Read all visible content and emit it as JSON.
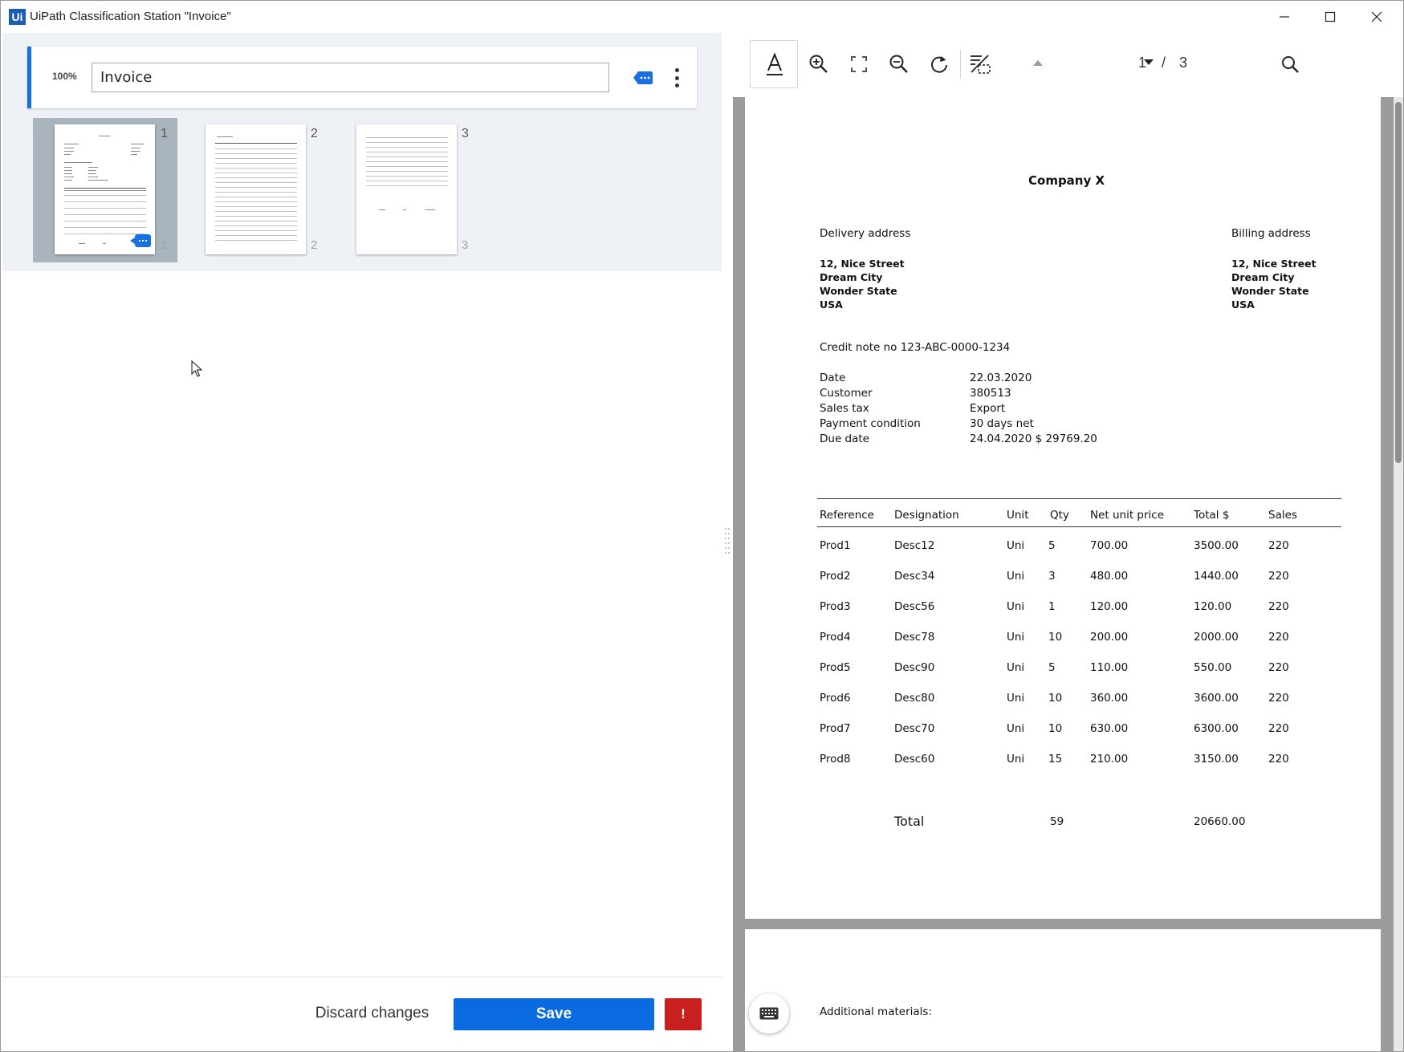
{
  "window": {
    "logo": "Ui",
    "title": "UiPath Classification Station \"Invoice\""
  },
  "document_type": {
    "confidence": "100%",
    "value": "Invoice"
  },
  "thumbnails": [
    {
      "page": "1",
      "label": "1"
    },
    {
      "page": "2",
      "label": "2"
    },
    {
      "page": "3",
      "label": "3"
    }
  ],
  "actions": {
    "discard": "Discard changes",
    "save": "Save",
    "warning": "!"
  },
  "toolbar": {
    "page_current": "1",
    "page_separator": "/",
    "page_total": "3",
    "icons": [
      "text-select-icon",
      "zoom-in-icon",
      "fit-page-icon",
      "zoom-out-icon",
      "rotate-icon",
      "toggle-regions-icon",
      "previous-page-icon",
      "next-page-icon",
      "search-icon"
    ]
  },
  "invoice": {
    "company": "Company X",
    "delivery_heading": "Delivery address",
    "billing_heading": "Billing address",
    "delivery_address": [
      "12, Nice Street",
      "Dream City",
      "Wonder State",
      "USA"
    ],
    "billing_address": [
      "12, Nice Street",
      "Dream City",
      "Wonder State",
      "USA"
    ],
    "credit_note": "Credit note no 123-ABC-0000-1234",
    "details": [
      {
        "label": "Date",
        "value": "22.03.2020"
      },
      {
        "label": "Customer",
        "value": "380513"
      },
      {
        "label": "Sales tax",
        "value": "Export"
      },
      {
        "label": "Payment condition",
        "value": "30 days net"
      },
      {
        "label": "Due date",
        "value": "24.04.2020 $ 29769.20"
      }
    ],
    "columns": [
      "Reference",
      "Designation",
      "Unit",
      "Qty",
      "Net unit price",
      "Total $",
      "Sales"
    ],
    "rows": [
      [
        "Prod1",
        "Desc12",
        "Uni",
        "5",
        "700.00",
        "3500.00",
        "220"
      ],
      [
        "Prod2",
        "Desc34",
        "Uni",
        "3",
        "480.00",
        "1440.00",
        "220"
      ],
      [
        "Prod3",
        "Desc56",
        "Uni",
        "1",
        "120.00",
        "120.00",
        "220"
      ],
      [
        "Prod4",
        "Desc78",
        "Uni",
        "10",
        "200.00",
        "2000.00",
        "220"
      ],
      [
        "Prod5",
        "Desc90",
        "Uni",
        "5",
        "110.00",
        "550.00",
        "220"
      ],
      [
        "Prod6",
        "Desc80",
        "Uni",
        "10",
        "360.00",
        "3600.00",
        "220"
      ],
      [
        "Prod7",
        "Desc70",
        "Uni",
        "10",
        "630.00",
        "6300.00",
        "220"
      ],
      [
        "Prod8",
        "Desc60",
        "Uni",
        "15",
        "210.00",
        "3150.00",
        "220"
      ]
    ],
    "total_label": "Total",
    "total_qty": "59",
    "total_amount": "20660.00"
  },
  "page2": {
    "additional_materials": "Additional materials:"
  },
  "colors": {
    "accent": "#0a6be0",
    "warning": "#c8201f",
    "panel_background": "#eef2f6",
    "viewer_background": "#9b9b9b"
  }
}
